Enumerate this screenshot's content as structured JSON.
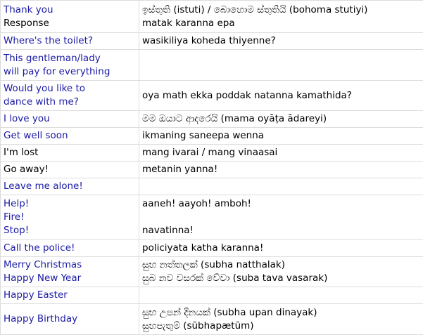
{
  "rows": [
    {
      "english": [
        "Thank you"
      ],
      "english_response": "Response",
      "sinhala": [
        "ඉස්තුති (istuti) / බොහොම ස්තුතියි (bohoma stutiyi)",
        "matak karanna epa"
      ]
    },
    {
      "english": [
        "Where's the toilet?"
      ],
      "sinhala": [
        "wasikiliya koheda thiyenne?"
      ]
    },
    {
      "english": [
        "This gentleman/lady",
        "will pay for everything"
      ],
      "sinhala": []
    },
    {
      "english": [
        "Would you like to",
        "dance with me?"
      ],
      "sinhala": [
        "oya math ekka poddak natanna kamathida?"
      ]
    },
    {
      "english": [
        "I love you"
      ],
      "sinhala": [
        "මම ඔයාට ආදරෙයි (mama oyāṭa ādareyi)"
      ]
    },
    {
      "english": [
        "Get well soon"
      ],
      "sinhala": [
        "ikmaning saneepa wenna"
      ]
    },
    {
      "english_black": [
        "I'm lost"
      ],
      "sinhala": [
        "mang ivarai / mang vinaasai"
      ]
    },
    {
      "english_black": [
        "Go away!"
      ],
      "sinhala": [
        "metanin yanna!"
      ]
    },
    {
      "english": [
        "Leave me alone!"
      ],
      "sinhala": []
    },
    {
      "english": [
        "Help!",
        "Fire!",
        "Stop!"
      ],
      "sinhala": [
        "aaneh! aayoh! amboh!",
        "",
        "navatinna!"
      ]
    },
    {
      "english": [
        "Call the police!"
      ],
      "sinhala": [
        "policiyata katha karanna!"
      ]
    },
    {
      "english": [
        "Merry Christmas",
        "Happy New Year"
      ],
      "sinhala": [
        "සුභ නත්තලක් (subha natthalak)",
        "සුබ නව වසරක් වේවා (suba tava vasarak)"
      ]
    },
    {
      "english": [
        "Happy Easter"
      ],
      "sinhala": []
    },
    {
      "english": [
        "Happy Birthday"
      ],
      "sinhala": [
        "සුභ උපන් දිනයක් (subha upan dinayak)",
        "සුභපැතුම් (sūbhapætūm)"
      ]
    }
  ],
  "colors": {
    "english_text": "#1a1aa6",
    "plain_text": "#000000",
    "border": "#dcdcdc"
  }
}
